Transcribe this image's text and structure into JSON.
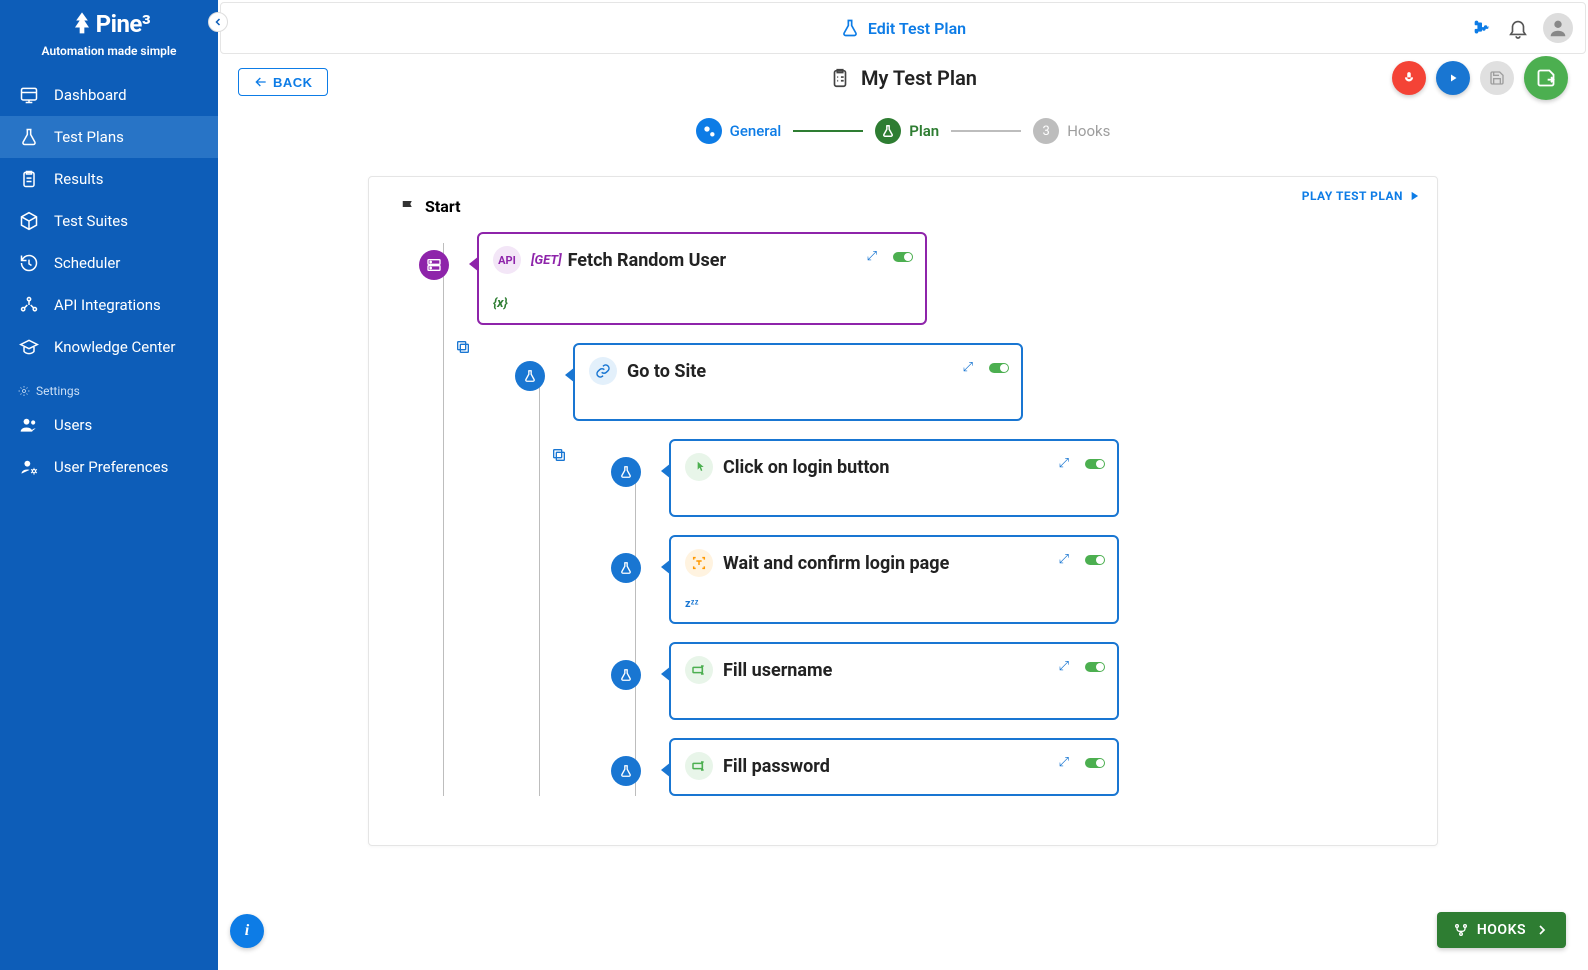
{
  "brand": {
    "name": "Pine³",
    "tagline": "Automation made simple"
  },
  "sidebar": {
    "items": [
      {
        "label": "Dashboard",
        "icon": "dashboard"
      },
      {
        "label": "Test Plans",
        "icon": "flask",
        "active": true
      },
      {
        "label": "Results",
        "icon": "clipboard"
      },
      {
        "label": "Test Suites",
        "icon": "cube"
      },
      {
        "label": "Scheduler",
        "icon": "history"
      },
      {
        "label": "API Integrations",
        "icon": "api"
      },
      {
        "label": "Knowledge Center",
        "icon": "graduation"
      }
    ],
    "settingsLabel": "Settings",
    "settingsItems": [
      {
        "label": "Users",
        "icon": "users"
      },
      {
        "label": "User Preferences",
        "icon": "user-cog"
      }
    ]
  },
  "page": {
    "headerTitle": "Edit Test Plan",
    "backLabel": "BACK",
    "planTitle": "My Test Plan"
  },
  "stepper": {
    "general": "General",
    "plan": "Plan",
    "hooks": "Hooks",
    "hooksNum": "3"
  },
  "canvas": {
    "playLabel": "PLAY TEST PLAN",
    "startLabel": "Start",
    "nodes": [
      {
        "title": "Fetch Random User",
        "apiTag": "API",
        "method": "[GET]",
        "var": "{x}",
        "kind": "api"
      },
      {
        "title": "Go to Site",
        "kind": "link"
      },
      {
        "title": "Click on login button",
        "kind": "click"
      },
      {
        "title": "Wait and confirm login page",
        "kind": "wait",
        "sleep": "zᶻᶻ"
      },
      {
        "title": "Fill username",
        "kind": "fill"
      },
      {
        "title": "Fill password",
        "kind": "fill"
      }
    ]
  },
  "footer": {
    "hooksBtn": "HOOKS"
  }
}
